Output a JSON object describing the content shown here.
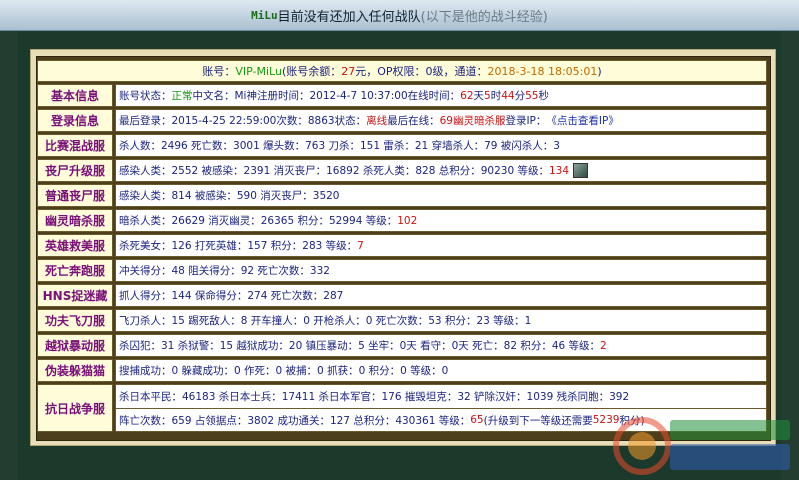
{
  "topbar": {
    "name": "MiLu",
    "msg": "目前没有还加入任何战队",
    "hint": "(以下是他的战斗经验)"
  },
  "account": {
    "l1": "账号：",
    "id": "VIP-MiLu",
    "l2": "(账号余额：",
    "balance": "27",
    "l3": "元，OP权限：",
    "op": "0级",
    "l4": "，通道：",
    "time": "2018-3-18 18:05:01",
    "l5": ")"
  },
  "basic": {
    "label": "基本信息",
    "a1": "账号状态：",
    "status": "正常",
    "a2": " 中文名：",
    "cn": "Mi神",
    "a3": " 注册时间：",
    "reg": "2012-4-7 10:37:00",
    "a4": " 在线时间：",
    "d": "62",
    "du": "天",
    "h": "5",
    "hu": "时",
    "m": "44",
    "mu": "分",
    "s": "55",
    "su": "秒"
  },
  "login": {
    "label": "登录信息",
    "a1": "最后登录：",
    "last": "2015-4-25 22:59:00",
    "a2": " 次数：",
    "count": "8863",
    "a3": " 状态：",
    "state": "离线",
    "a4": " 最后在线：",
    "server": "69幽灵暗杀服",
    "a5": " 登录IP：",
    "ip": "《点击查看IP》"
  },
  "mixed": {
    "label": "比赛混战服",
    "text": "杀人数：2496 死亡数：3001 爆头数：763 刀杀：151 雷杀：21 穿墙杀人：79 被闪杀人：3"
  },
  "zombie": {
    "label": "丧尸升级服",
    "text": "感染人类：2552 被感染：2391 消灭丧尸：16892 杀死人类：828 总积分：90230 等级：",
    "level": "134"
  },
  "normal_zombie": {
    "label": "普通丧尸服",
    "text": "感染人类：814 被感染：590 消灭丧尸：3520"
  },
  "ghost": {
    "label": "幽灵暗杀服",
    "text": "暗杀人类：26629 消灭幽灵：26365 积分：52994 等级：",
    "level": "102"
  },
  "hero": {
    "label": "英雄救美服",
    "text": "杀死美女：126 打死英雄：157 积分：283 等级：",
    "level": "7"
  },
  "death_run": {
    "label": "死亡奔跑服",
    "text": "冲关得分：48 阻关得分：92 死亡次数：332"
  },
  "hns": {
    "label": "HNS捉迷藏",
    "text": "抓人得分：144 保命得分：274 死亡次数：287"
  },
  "kungfu": {
    "label": "功夫飞刀服",
    "text": "飞刀杀人：15 踢死敌人：8 开车撞人：0 开枪杀人：0 死亡次数：53 积分：23 等级：1"
  },
  "jailbreak": {
    "label": "越狱暴动服",
    "a1": "杀囚犯：31 杀狱警：15 越狱成功：20 镇压暴动：5 坐牢：0天 看守：0天 死亡：82 积分：46 等级：",
    "level": "2"
  },
  "catmouse": {
    "label": "伪装躲猫猫",
    "text": "搜捕成功：0 躲藏成功：0 作死：0 被捕：0 抓获：0 积分：0 等级：0"
  },
  "antijapan": {
    "label": "抗日战争服",
    "line1": "杀日本平民：46183 杀日本士兵：17411 杀日本军官：176 摧毁坦克：32 铲除汉奸：1039 残杀同胞：392",
    "line2a": "阵亡次数：659 占领据点：3802 成功通关：127 总积分：430361 等级：",
    "level": "65",
    "line2b": " (升级到下一等级还需要",
    "need": "5239",
    "line2c": "积分)"
  },
  "colors": {
    "background": "#1c3a2c",
    "label_text": "#7a0f7a",
    "value_text": "#1c2480",
    "highlight": "#cc1111",
    "panel": "#4e3f1c"
  },
  "icons": {
    "avatar": "avatar-icon",
    "watermark": "site-logo-watermark"
  }
}
